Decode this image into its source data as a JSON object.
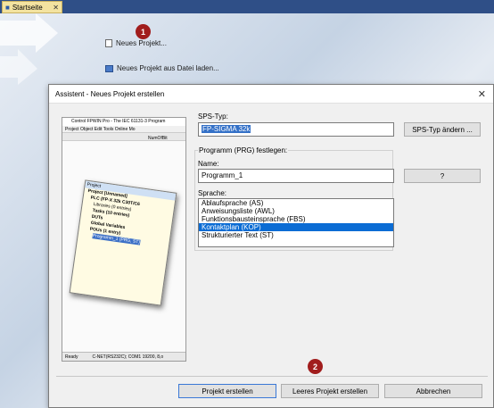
{
  "tab": {
    "label": "Startseite",
    "close": "✕"
  },
  "start_page": {
    "new_project": "Neues Projekt...",
    "new_project_from_file": "Neues Projekt aus Datei laden..."
  },
  "badges": {
    "one": "1",
    "two": "2"
  },
  "dialog": {
    "title": "Assistent - Neues Projekt erstellen",
    "close": "✕",
    "plc_type_label": "SPS-Typ:",
    "plc_type_value": "FP-SIGMA 32k",
    "change_plc_button": "SPS-Typ ändern ...",
    "program_group_label": "Programm (PRG) festlegen:",
    "name_label": "Name:",
    "name_value": "Programm_1",
    "help_button": "?",
    "language_label": "Sprache:",
    "languages": [
      "Ablaufsprache (AS)",
      "Anweisungsliste (AWL)",
      "Funktionsbausteinsprache (FBS)",
      "Kontaktplan (KOP)",
      "Strukturierter Text (ST)"
    ],
    "selected_language_index": 3,
    "create_button": "Projekt erstellen",
    "create_empty_button": "Leeres Projekt erstellen",
    "cancel_button": "Abbrechen"
  },
  "preview": {
    "title": "Control FPWIN Pro - The IEC 61131-3 Program",
    "menu": "Project  Object  Edit  Tools  Online  Mo",
    "toolbar_text": "NumOfBit",
    "pane_title": "Project",
    "tree": [
      "Project [Unnamed]",
      "PLC (FP-X 32k C30T/C6",
      "Libraries (0 entries)",
      "Tasks (10 entries)",
      "DUTs",
      "Global Variables",
      "POUs (1 entry)",
      "Programm_1 (PRG, ST)"
    ],
    "status_ready": "Ready",
    "status_conn": "C-NET(RS232C); COM1 19200, 8,o"
  },
  "colors": {
    "accent": "#0b6cd4",
    "badge": "#a11d1d",
    "tabbar": "#2f4f87"
  }
}
